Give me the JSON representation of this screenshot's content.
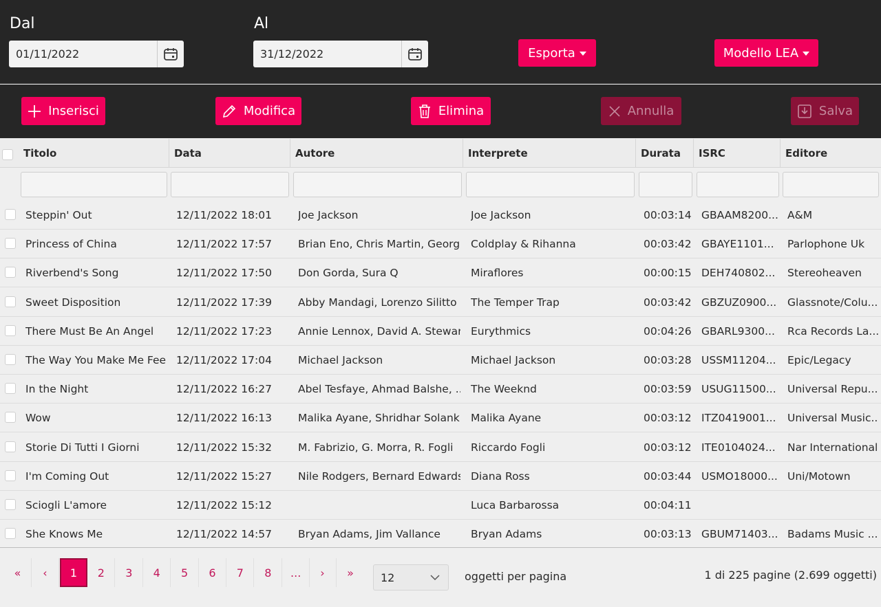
{
  "filters": {
    "from_label": "Dal",
    "from_value": "01/11/2022",
    "to_label": "Al",
    "to_value": "31/12/2022",
    "export_label": "Esporta",
    "model_label": "Modello LEA"
  },
  "actions": {
    "insert": "Inserisci",
    "edit": "Modifica",
    "delete": "Elimina",
    "cancel": "Annulla",
    "save": "Salva"
  },
  "columns": [
    "Titolo",
    "Data",
    "Autore",
    "Interprete",
    "Durata",
    "ISRC",
    "Editore"
  ],
  "rows": [
    {
      "title": "Steppin' Out",
      "date": "12/11/2022 18:01",
      "author": "Joe Jackson",
      "performer": "Joe Jackson",
      "duration": "00:03:14",
      "isrc": "GBAAM8200...",
      "publisher": "A&M"
    },
    {
      "title": "Princess of China",
      "date": "12/11/2022 17:57",
      "author": "Brian Eno, Chris Martin, Georg ...",
      "performer": "Coldplay & Rihanna",
      "duration": "00:03:42",
      "isrc": "GBAYE1101...",
      "publisher": "Parlophone Uk"
    },
    {
      "title": "Riverbend's Song",
      "date": "12/11/2022 17:50",
      "author": "Don Gorda, Sura Q",
      "performer": "Miraflores",
      "duration": "00:00:15",
      "isrc": "DEH740802...",
      "publisher": "Stereoheaven"
    },
    {
      "title": "Sweet Disposition",
      "date": "12/11/2022 17:39",
      "author": "Abby Mandagi, Lorenzo Silitto",
      "performer": "The Temper Trap",
      "duration": "00:03:42",
      "isrc": "GBZUZ0900...",
      "publisher": "Glassnote/Colu..."
    },
    {
      "title": "There Must Be An Angel",
      "date": "12/11/2022 17:23",
      "author": "Annie Lennox, David A. Stewart",
      "performer": "Eurythmics",
      "duration": "00:04:26",
      "isrc": "GBARL9300...",
      "publisher": "Rca Records La..."
    },
    {
      "title": "The Way You Make Me Feel",
      "date": "12/11/2022 17:04",
      "author": "Michael Jackson",
      "performer": "Michael Jackson",
      "duration": "00:03:28",
      "isrc": "USSM11204...",
      "publisher": "Epic/Legacy"
    },
    {
      "title": "In the Night",
      "date": "12/11/2022 16:27",
      "author": "Abel Tesfaye, Ahmad Balshe, ...",
      "performer": "The Weeknd",
      "duration": "00:03:59",
      "isrc": "USUG11500...",
      "publisher": "Universal Repu..."
    },
    {
      "title": "Wow",
      "date": "12/11/2022 16:13",
      "author": "Malika Ayane, Shridhar Solanki",
      "performer": "Malika Ayane",
      "duration": "00:03:12",
      "isrc": "ITZ0419001...",
      "publisher": "Universal Music..."
    },
    {
      "title": "Storie Di Tutti I Giorni",
      "date": "12/11/2022 15:32",
      "author": "M. Fabrizio, G. Morra, R. Fogli",
      "performer": "Riccardo Fogli",
      "duration": "00:03:12",
      "isrc": "ITE0104024...",
      "publisher": "Nar International"
    },
    {
      "title": "I'm Coming Out",
      "date": "12/11/2022 15:27",
      "author": "Nile Rodgers, Bernard Edwards",
      "performer": "Diana Ross",
      "duration": "00:03:44",
      "isrc": "USMO18000...",
      "publisher": "Uni/Motown"
    },
    {
      "title": "Sciogli L'amore",
      "date": "12/11/2022 15:12",
      "author": "",
      "performer": "Luca Barbarossa",
      "duration": "00:04:11",
      "isrc": "",
      "publisher": ""
    },
    {
      "title": "She Knows Me",
      "date": "12/11/2022 14:57",
      "author": "Bryan Adams, Jim Vallance",
      "performer": "Bryan Adams",
      "duration": "00:03:13",
      "isrc": "GBUM71403...",
      "publisher": "Badams Music ..."
    }
  ],
  "pager": {
    "first": "«",
    "prev": "‹",
    "pages": [
      "1",
      "2",
      "3",
      "4",
      "5",
      "6",
      "7",
      "8",
      "..."
    ],
    "current": "1",
    "next": "›",
    "last": "»",
    "page_size": "12",
    "page_size_label": "oggetti per pagina",
    "info": "1 di 225 pagine (2.699 oggetti)"
  },
  "colors": {
    "accent": "#f1005b",
    "dark_bg": "#262626",
    "disabled": "#8a1238"
  }
}
